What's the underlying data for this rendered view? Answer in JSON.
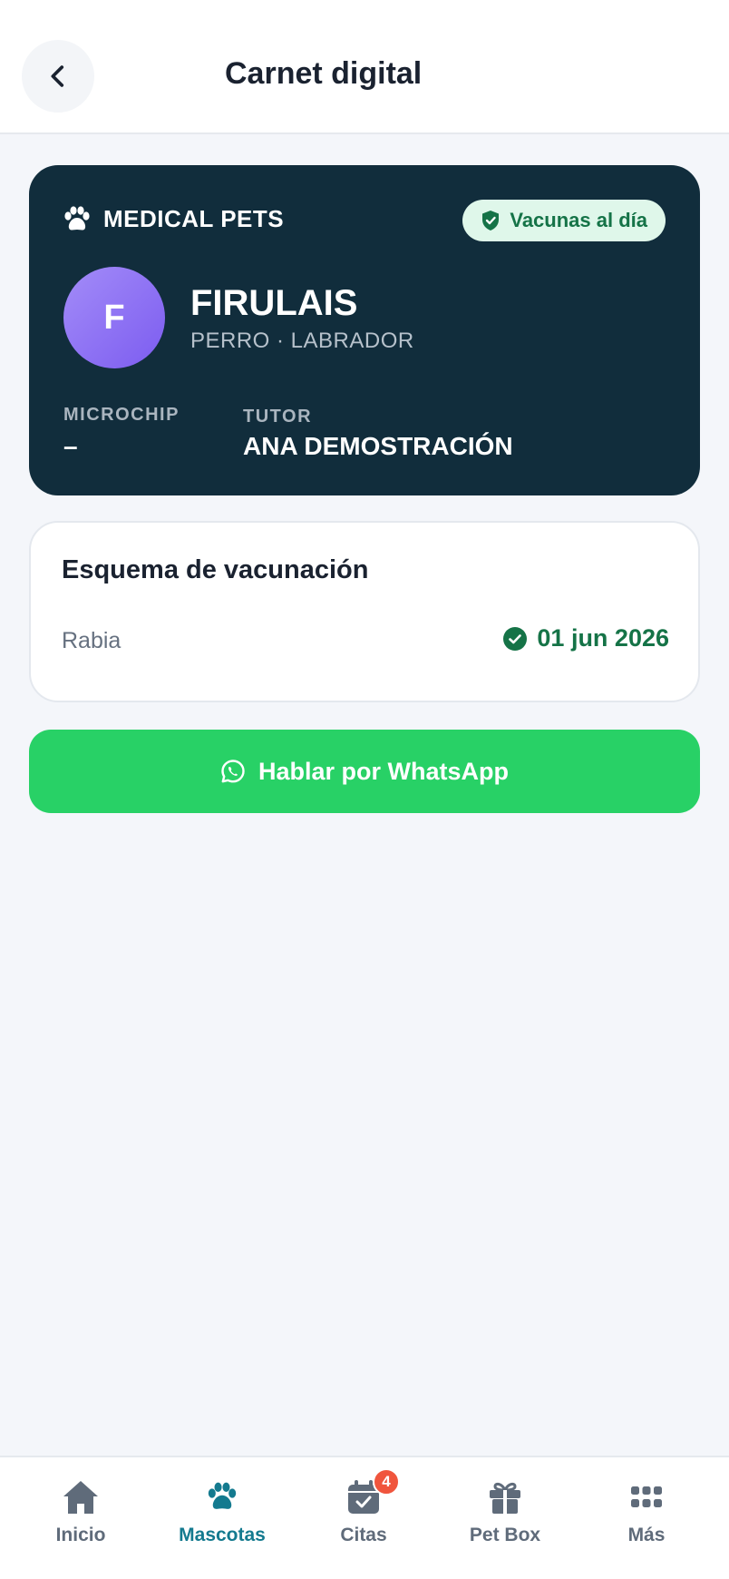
{
  "header": {
    "title": "Carnet digital",
    "back_icon": "chevron-left-icon"
  },
  "pet_card": {
    "brand": "MEDICAL PETS",
    "brand_icon": "paw-icon",
    "status_badge": "Vacunas al día",
    "status_icon": "shield-check-icon",
    "avatar_initial": "F",
    "name": "FIRULAIS",
    "species_breed": "PERRO · LABRADOR",
    "microchip_label": "MICROCHIP",
    "microchip_value": "–",
    "tutor_label": "TUTOR",
    "tutor_value": "ANA DEMOSTRACIÓN"
  },
  "vaccination": {
    "title": "Esquema de vacunación",
    "items": [
      {
        "name": "Rabia",
        "date": "01 jun 2026",
        "status_icon": "check-circle-icon"
      }
    ]
  },
  "whatsapp_button": {
    "label": "Hablar por WhatsApp",
    "icon": "whatsapp-icon"
  },
  "bottom_nav": {
    "items": [
      {
        "label": "Inicio",
        "icon": "home-icon"
      },
      {
        "label": "Mascotas",
        "icon": "paw-icon",
        "active": true
      },
      {
        "label": "Citas",
        "icon": "calendar-check-icon",
        "badge": "4"
      },
      {
        "label": "Pet Box",
        "icon": "gift-icon"
      },
      {
        "label": "Más",
        "icon": "grid-icon"
      }
    ]
  },
  "colors": {
    "card_bg": "#112d3c",
    "accent_green": "#157347",
    "whatsapp_green": "#28d166",
    "nav_active": "#147a8f",
    "badge_red": "#f0553d",
    "avatar_purple": "#7c5cf0"
  }
}
